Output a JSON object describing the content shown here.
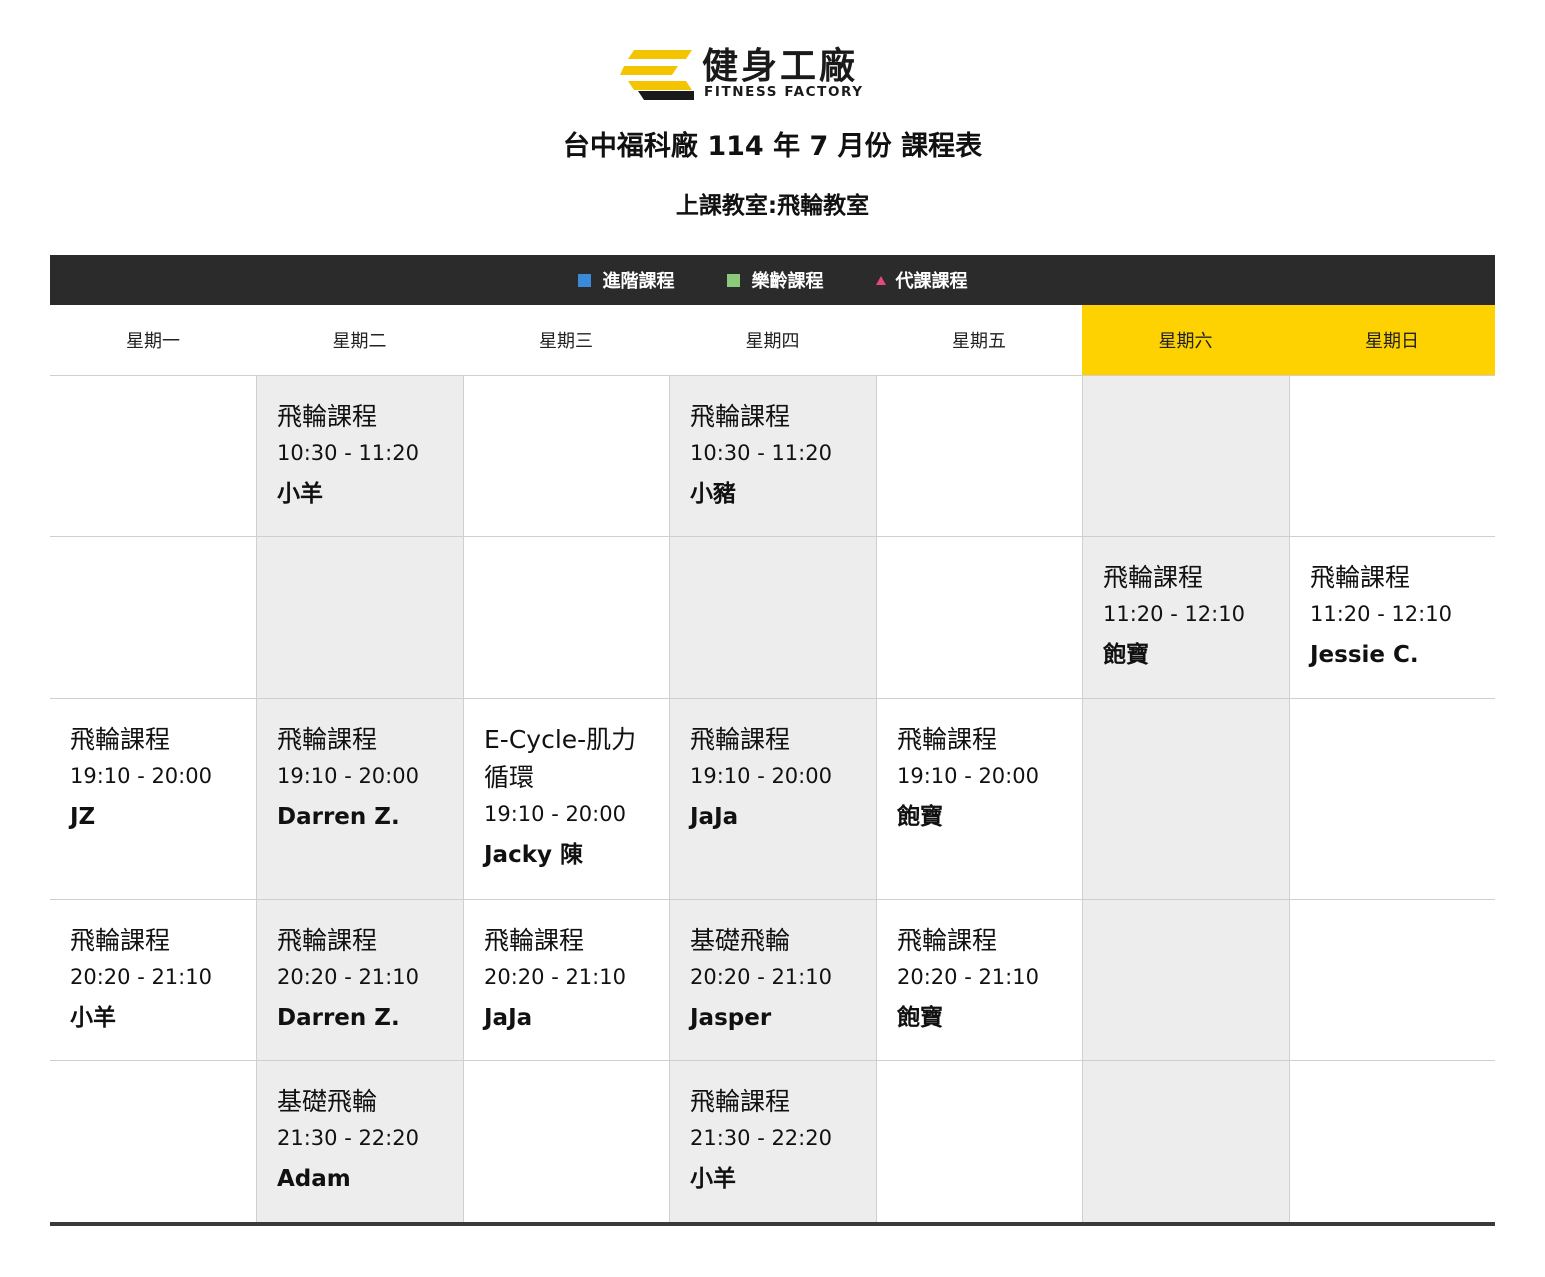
{
  "brand": {
    "name_cn": "健身工廠",
    "name_en": "FITNESS FACTORY",
    "colors": {
      "yellow": "#f5c400",
      "dark": "#1a1a1a"
    }
  },
  "header": {
    "title": "台中福科廠 114 年 7 月份 課程表",
    "room": "上課教室:飛輪教室"
  },
  "legend": [
    {
      "label": "進階課程",
      "marker": "square",
      "color": "#3b8ad9"
    },
    {
      "label": "樂齡課程",
      "marker": "square",
      "color": "#8cc97a"
    },
    {
      "label": "代課課程",
      "marker": "triangle",
      "color": "#e5487a"
    }
  ],
  "days": [
    "星期一",
    "星期二",
    "星期三",
    "星期四",
    "星期五",
    "星期六",
    "星期日"
  ],
  "colors": {
    "weekend_header": "#fdd200",
    "shaded_column": "#ededed",
    "legend_bar": "#2b2b2b"
  },
  "rows": [
    {
      "cells": [
        null,
        {
          "name": "飛輪課程",
          "time": "10:30 - 11:20",
          "teacher": "小羊"
        },
        null,
        {
          "name": "飛輪課程",
          "time": "10:30 - 11:20",
          "teacher": "小豬"
        },
        null,
        null,
        null
      ]
    },
    {
      "cells": [
        null,
        null,
        null,
        null,
        null,
        {
          "name": "飛輪課程",
          "time": "11:20 - 12:10",
          "teacher": "飽寶"
        },
        {
          "name": "飛輪課程",
          "time": "11:20 - 12:10",
          "teacher": "Jessie C."
        }
      ]
    },
    {
      "cells": [
        {
          "name": "飛輪課程",
          "time": "19:10 - 20:00",
          "teacher": "JZ"
        },
        {
          "name": "飛輪課程",
          "time": "19:10 - 20:00",
          "teacher": "Darren Z."
        },
        {
          "name": "E-Cycle-肌力循環",
          "time": "19:10 - 20:00",
          "teacher": "Jacky 陳"
        },
        {
          "name": "飛輪課程",
          "time": "19:10 - 20:00",
          "teacher": "JaJa"
        },
        {
          "name": "飛輪課程",
          "time": "19:10 - 20:00",
          "teacher": "飽寶"
        },
        null,
        null
      ]
    },
    {
      "cells": [
        {
          "name": "飛輪課程",
          "time": "20:20 - 21:10",
          "teacher": "小羊"
        },
        {
          "name": "飛輪課程",
          "time": "20:20 - 21:10",
          "teacher": "Darren Z."
        },
        {
          "name": "飛輪課程",
          "time": "20:20 - 21:10",
          "teacher": "JaJa"
        },
        {
          "name": "基礎飛輪",
          "time": "20:20 - 21:10",
          "teacher": "Jasper"
        },
        {
          "name": "飛輪課程",
          "time": "20:20 - 21:10",
          "teacher": "飽寶"
        },
        null,
        null
      ]
    },
    {
      "cells": [
        null,
        {
          "name": "基礎飛輪",
          "time": "21:30 - 22:20",
          "teacher": "Adam"
        },
        null,
        {
          "name": "飛輪課程",
          "time": "21:30 - 22:20",
          "teacher": "小羊"
        },
        null,
        null,
        null
      ]
    }
  ]
}
